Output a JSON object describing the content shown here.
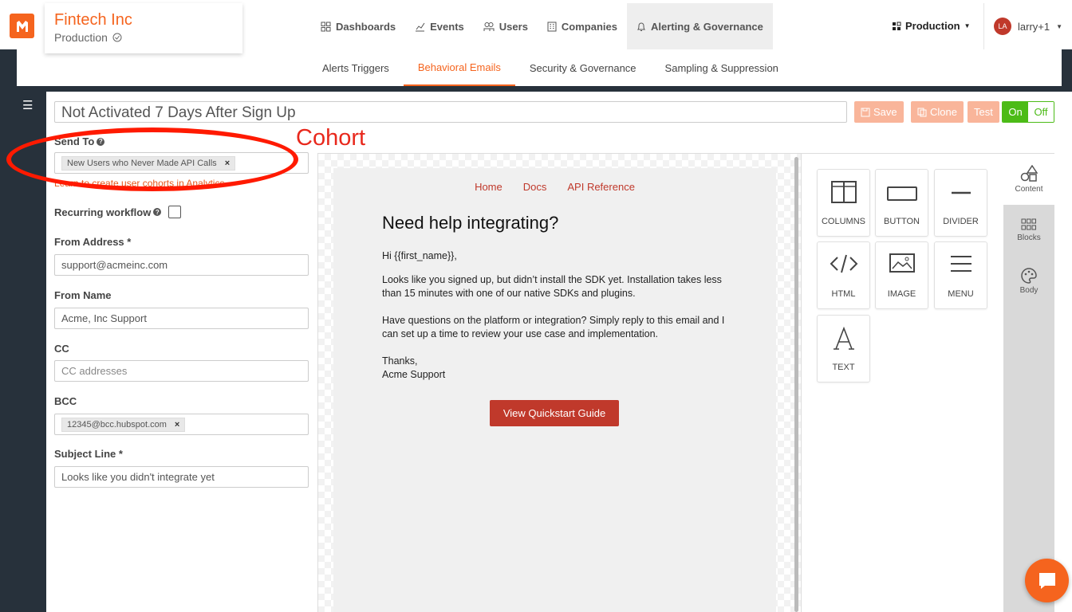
{
  "brand": {
    "name": "Fintech Inc",
    "environment": "Production"
  },
  "nav": {
    "items": [
      {
        "label": "Dashboards",
        "icon": "grid-icon"
      },
      {
        "label": "Events",
        "icon": "chart-icon"
      },
      {
        "label": "Users",
        "icon": "users-icon"
      },
      {
        "label": "Companies",
        "icon": "building-icon"
      },
      {
        "label": "Alerting & Governance",
        "icon": "bell-icon",
        "active": true
      }
    ],
    "env_switch": "Production",
    "user": {
      "initials": "LA",
      "name": "larry+1"
    }
  },
  "subtabs": [
    "Alerts Triggers",
    "Behavioral Emails",
    "Security & Governance",
    "Sampling & Suppression"
  ],
  "workflow": {
    "title": "Not Activated 7 Days After Sign Up",
    "buttons": {
      "save": "Save",
      "clone": "Clone",
      "test": "Test"
    },
    "toggle": {
      "on": "On",
      "off": "Off"
    }
  },
  "form": {
    "send_to_label": "Send To",
    "send_to_chip": "New Users who Never Made API Calls",
    "send_to_hint": "Learn to create user cohorts in Analytics.",
    "recurring_label": "Recurring workflow",
    "from_address_label": "From Address *",
    "from_address_value": "support@acmeinc.com",
    "from_name_label": "From Name",
    "from_name_value": "Acme, Inc Support",
    "cc_label": "CC",
    "cc_placeholder": "CC addresses",
    "bcc_label": "BCC",
    "bcc_chip": "12345@bcc.hubspot.com",
    "subject_label": "Subject Line *",
    "subject_value": "Looks like you didn't integrate yet"
  },
  "annotation": {
    "text": "Cohort",
    "color": "#ff1a00"
  },
  "email": {
    "nav": [
      "Home",
      "Docs",
      "API Reference"
    ],
    "heading": "Need help integrating?",
    "greeting": "Hi {{first_name}},",
    "para1": "Looks like you signed up, but didn’t install the SDK yet. Installation takes less than 15 minutes with one of our native SDKs and plugins.",
    "para2": "Have questions on the platform or integration? Simply reply to this email and I can set up a time to review your use case and implementation.",
    "signoff1": "Thanks,",
    "signoff2": "Acme Support",
    "cta": "View Quickstart Guide"
  },
  "tools": [
    "COLUMNS",
    "BUTTON",
    "DIVIDER",
    "HTML",
    "IMAGE",
    "MENU",
    "TEXT"
  ],
  "side_tabs": [
    "Content",
    "Blocks",
    "Body"
  ],
  "colors": {
    "accent": "#f5641e",
    "email_link": "#c0392b",
    "toggle_on": "#4cbb17"
  }
}
